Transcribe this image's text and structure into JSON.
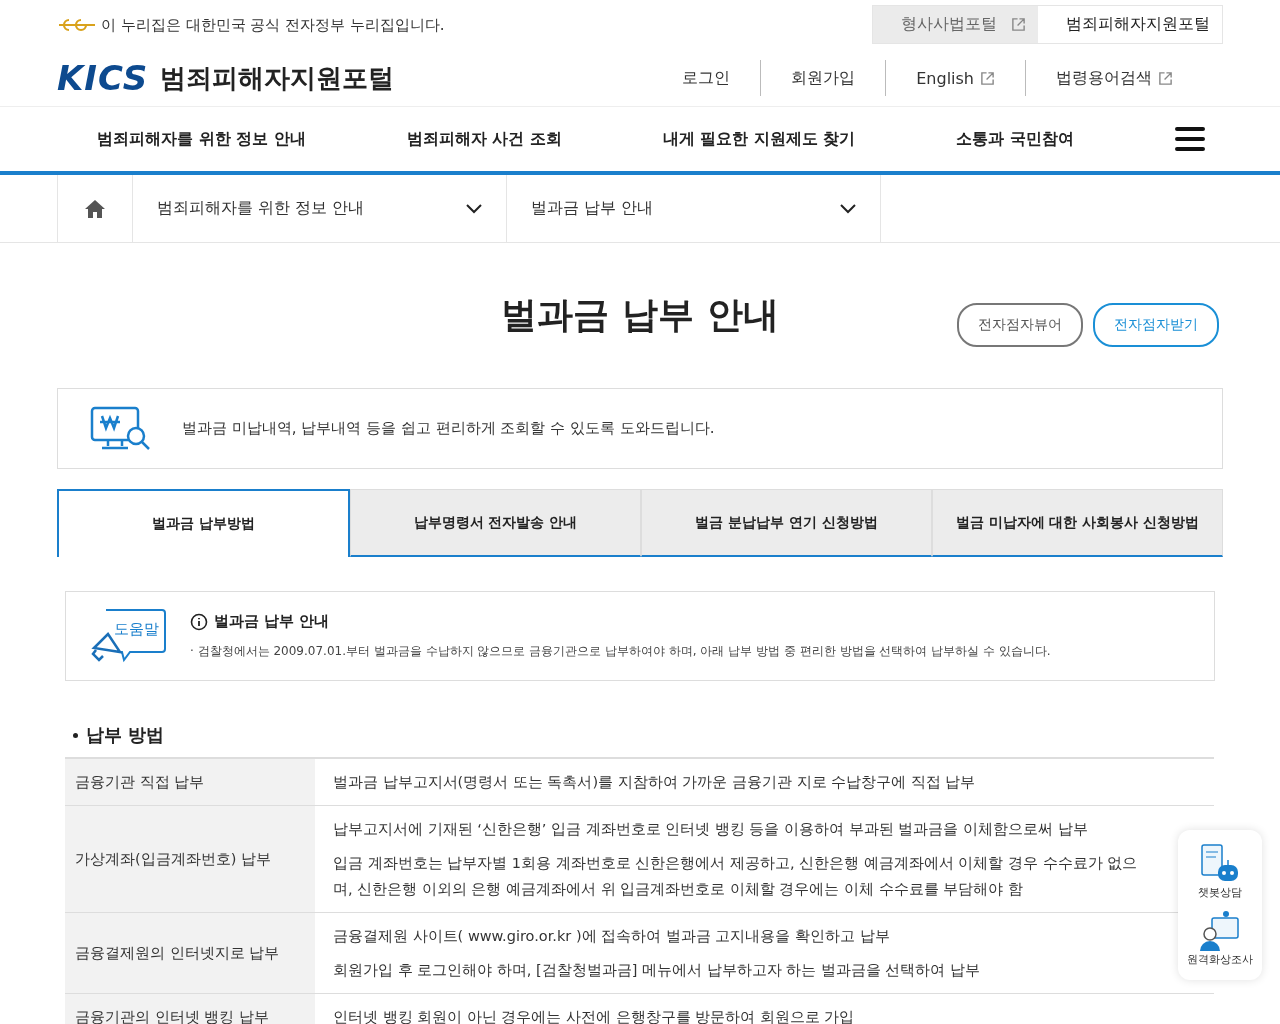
{
  "gov_banner": {
    "text": "이 누리집은 대한민국 공식 전자정부 누리집입니다."
  },
  "portal_switch": [
    {
      "label": "형사사법포털",
      "external": true,
      "selected": false
    },
    {
      "label": "범죄피해자지원포털",
      "external": false,
      "selected": true
    }
  ],
  "logo": {
    "mark": "KICS",
    "title": "범죄피해자지원포털"
  },
  "util_links": [
    {
      "label": "로그인",
      "external": false
    },
    {
      "label": "회원가입",
      "external": false
    },
    {
      "label": "English",
      "external": true
    },
    {
      "label": "법령용어검색",
      "external": true
    }
  ],
  "main_nav": [
    "범죄피해자를 위한 정보 안내",
    "범죄피해자 사건 조회",
    "내게 필요한 지원제도 찾기",
    "소통과 국민참여"
  ],
  "breadcrumb": [
    "범죄피해자를 위한 정보 안내",
    "벌과금 납부 안내"
  ],
  "page_title": "벌과금 납부 안내",
  "braille_buttons": [
    {
      "label": "전자점자뷰어",
      "kind": "plain"
    },
    {
      "label": "전자점자받기",
      "kind": "primary"
    }
  ],
  "intro": "벌과금 미납내역, 납부내역 등을 쉽고 편리하게 조회할 수 있도록 도와드립니다.",
  "tabs": [
    {
      "label": "벌과금 납부방법",
      "selected": true
    },
    {
      "label": "납부명령서 전자발송 안내",
      "selected": false
    },
    {
      "label": "벌금 분납납부 연기 신청방법",
      "selected": false
    },
    {
      "label": "벌금 미납자에 대한 사회봉사 신청방법",
      "selected": false
    }
  ],
  "help": {
    "badge": "도움말",
    "title": "벌과금 납부 안내",
    "text": "· 검찰청에서는 2009.07.01.부터 벌과금을 수납하지 않으므로 금융기관으로 납부하여야 하며, 아래 납부 방법 중 편리한 방법을 선택하여 납부하실 수 있습니다."
  },
  "section_heading": "납부 방법",
  "table": {
    "rows": [
      {
        "method": "금융기관 직접 납부",
        "details": [
          "벌과금 납부고지서(명령서 또는 독촉서)를 지참하여 가까운 금융기관 지로 수납창구에 직접 납부"
        ]
      },
      {
        "method": "가상계좌(입금계좌번호) 납부",
        "details": [
          "납부고지서에 기재된 ‘신한은행’ 입금 계좌번호로 인터넷 뱅킹 등을 이용하여 부과된 벌과금을 이체함으로써 납부",
          "입금 계좌번호는 납부자별 1회용 계좌번호로 신한은행에서 제공하고, 신한은행 예금계좌에서 이체할 경우 수수료가 없으며, 신한은행 이외의 은행 예금계좌에서 위 입금계좌번호로 이체할 경우에는 이체 수수료를 부담해야 함"
        ]
      },
      {
        "method": "금융결제원의 인터넷지로 납부",
        "details": [
          "금융결제원 사이트( www.giro.or.kr )에 접속하여 벌과금 고지내용을 확인하고 납부",
          "회원가입 후 로그인해야 하며, [검찰청벌과금] 메뉴에서 납부하고자 하는 벌과금을 선택하여 납부"
        ]
      },
      {
        "method": "금융기관의 인터넷 뱅킹 납부",
        "details": [
          "인터넷 뱅킹 회원이 아닌 경우에는 사전에 은행창구를 방문하여 회원으로 가입"
        ]
      }
    ]
  },
  "quick_menu": [
    {
      "label": "챗봇상담",
      "kind": "chatbot"
    },
    {
      "label": "원격화상조사",
      "kind": "video"
    }
  ]
}
